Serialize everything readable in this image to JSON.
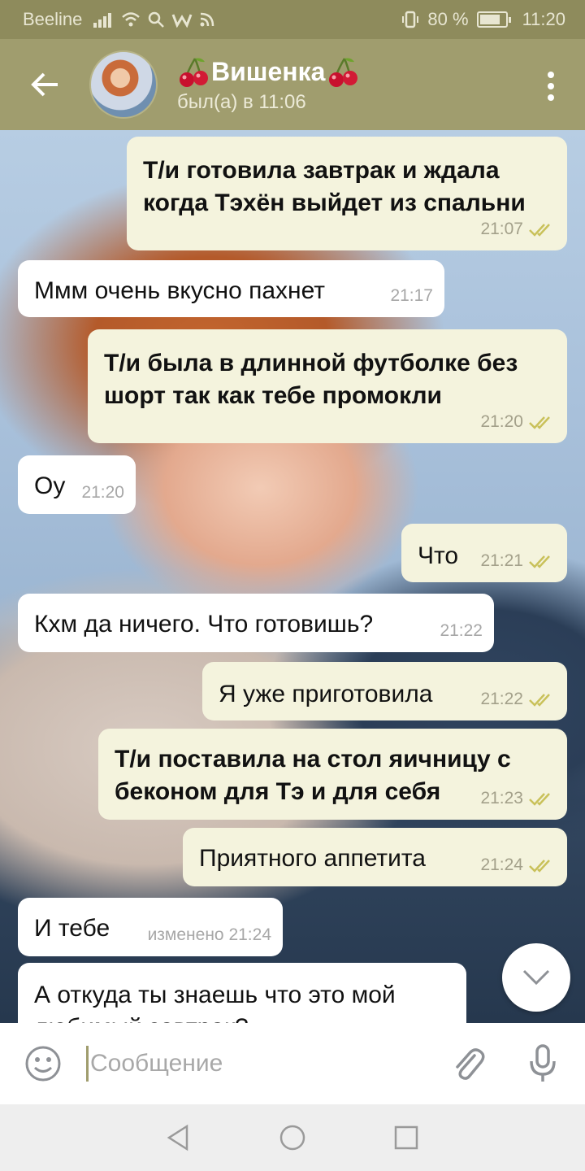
{
  "status_bar": {
    "carrier": "Beeline",
    "signal_icons": "ıııl •",
    "battery_percent": "80 %",
    "battery_level": 0.8,
    "time": "11:20"
  },
  "header": {
    "title": "Вишенка",
    "last_seen": "был(а) в 11:06"
  },
  "messages": [
    {
      "dir": "out",
      "text": "Т/и готовила завтрак и ждала когда Тэхён выйдет из спальни",
      "time": "21:07"
    },
    {
      "dir": "in",
      "text": "Ммм очень вкусно пахнет",
      "time": "21:17"
    },
    {
      "dir": "out",
      "text": "Т/и была в длинной футболке без шорт так как тебе промокли",
      "time": "21:20"
    },
    {
      "dir": "in",
      "text": "Оу",
      "time": "21:20"
    },
    {
      "dir": "out",
      "text": "Что",
      "time": "21:21"
    },
    {
      "dir": "in",
      "text": "Кхм да ничего. Что готовишь?",
      "time": "21:22"
    },
    {
      "dir": "out",
      "text": "Я уже приготовила",
      "time": "21:22"
    },
    {
      "dir": "out",
      "text": "Т/и поставила на стол яичницу с беконом для Тэ и для себя",
      "time": "21:23"
    },
    {
      "dir": "out",
      "text": "Приятного аппетита",
      "time": "21:24"
    },
    {
      "dir": "in",
      "text": "И тебе",
      "time": "изменено 21:24"
    },
    {
      "dir": "in",
      "text": "А откуда ты знаешь что это мой любимый завтрак?",
      "time": ""
    }
  ],
  "input": {
    "placeholder": "Сообщение"
  },
  "colors": {
    "header": "#a09d6e",
    "status_bar": "#8e8b5c",
    "outgoing_bubble": "#f4f3dd",
    "incoming_bubble": "#ffffff",
    "read_ticks": "#c9c15a"
  },
  "icons": [
    "back-arrow-icon",
    "cherry-icon",
    "more-vert-icon",
    "read-ticks-icon",
    "chevron-down-icon",
    "emoji-icon",
    "attach-icon",
    "mic-icon",
    "nav-back-icon",
    "nav-home-icon",
    "nav-recents-icon"
  ]
}
